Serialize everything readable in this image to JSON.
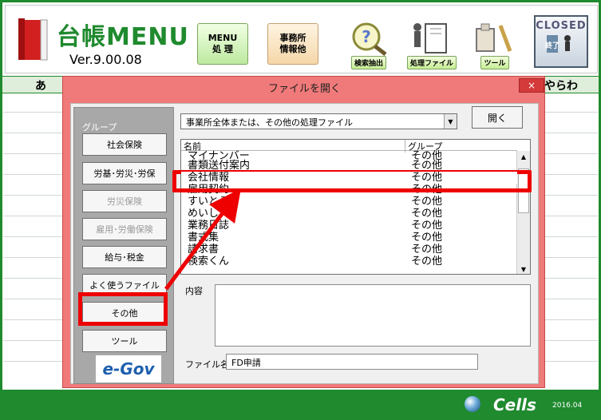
{
  "app": {
    "logo_title": "台帳MENU",
    "version": "Ver.9.00.08"
  },
  "header_buttons": {
    "menu": "MENU\n処 理",
    "office": "事務所\n情報他",
    "search": "検索抽出",
    "files": "処理ファイル",
    "tools": "ツール",
    "closed": "CLOSED",
    "closed_sub": "終了"
  },
  "sheet": {
    "left_label": "あ",
    "right_label": "やらわ"
  },
  "dialog": {
    "title": "ファイルを開く",
    "close": "×",
    "group_legend": "グループ",
    "groups": [
      {
        "label": "社会保険",
        "enabled": true
      },
      {
        "label": "労基･労災･労保",
        "enabled": true
      },
      {
        "label": "労災保険",
        "enabled": false
      },
      {
        "label": "雇用･労働保険",
        "enabled": false
      },
      {
        "label": "給与･税金",
        "enabled": true
      },
      {
        "label": "よく使うファイル",
        "enabled": true
      },
      {
        "label": "その他",
        "enabled": true
      },
      {
        "label": "ツール",
        "enabled": true
      }
    ],
    "egov_label": "e-Gov",
    "combo_value": "事業所全体または、その他の処理ファイル",
    "open_button": "開く",
    "list_headers": {
      "name": "名前",
      "group": "グループ"
    },
    "list_rows": [
      {
        "name": "マイナンバー",
        "group": "その他"
      },
      {
        "name": "書類送付案内",
        "group": "その他"
      },
      {
        "name": "会社情報",
        "group": "その他"
      },
      {
        "name": "雇用契約",
        "group": "その他"
      },
      {
        "name": "すいとる",
        "group": "その他"
      },
      {
        "name": "めいし",
        "group": "その他"
      },
      {
        "name": "業務日誌",
        "group": "その他"
      },
      {
        "name": "書式集",
        "group": "その他"
      },
      {
        "name": "請求書",
        "group": "その他"
      },
      {
        "name": "検索くん",
        "group": "その他"
      }
    ],
    "content_label": "内容",
    "filename_label": "ファイル名",
    "filename_value": "FD申請"
  },
  "footer": {
    "brand": "Cells",
    "year": "2016.04"
  },
  "colors": {
    "frame_green": "#1f8a2e",
    "dialog_red": "#f07a7a",
    "highlight_red": "#ee0000"
  }
}
